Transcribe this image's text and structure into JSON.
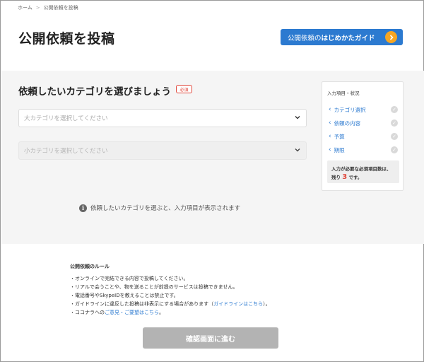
{
  "breadcrumb": {
    "items": [
      "ホーム",
      "公開依頼を投稿"
    ],
    "separator": ">"
  },
  "header": {
    "title": "公開依頼を投稿",
    "guide_button": {
      "prefix": "公開依頼の",
      "strong": "はじめかたガイド",
      "icon": "chevron-right-icon"
    }
  },
  "form": {
    "section_title": "依頼したいカテゴリを選びましょう",
    "required_badge": "必須",
    "large_category": {
      "placeholder": "大カテゴリを選択してください"
    },
    "small_category": {
      "placeholder": "小カテゴリを選択してください"
    },
    "info_text": "依頼したいカテゴリを選ぶと、入力項目が表示されます"
  },
  "status": {
    "title": "入力項目・状況",
    "items": [
      {
        "label": "カテゴリ選択"
      },
      {
        "label": "依頼の内容"
      },
      {
        "label": "予算"
      },
      {
        "label": "期限"
      }
    ],
    "remain_prefix": "入力が必要な必須項目数は、",
    "remain_pre": "残り",
    "remain_count": "3",
    "remain_suffix": "です。"
  },
  "rules": {
    "title": "公開依頼のルール",
    "line1": "・オンラインで完結できる内容で投稿してください。",
    "line2": "・リアルで会うことや、物を送ることが前提のサービスは投稿できません。",
    "line3": "・電話番号やSkypeIDを教えることは禁止です。",
    "line4_pre": "・ガイドラインに違反した投稿は非表示にする場合があります（",
    "line4_link": "ガイドラインはこちら",
    "line4_post": "）。",
    "line5_pre": "・ココナラへの",
    "line5_link": "ご意見・ご要望はこちら",
    "line5_post": "。"
  },
  "confirm_button": "確認画面に進む",
  "colors": {
    "primary": "#2c7ad0",
    "accent": "#f6a623",
    "required": "#e0473b",
    "disabled": "#b3b3b3"
  }
}
